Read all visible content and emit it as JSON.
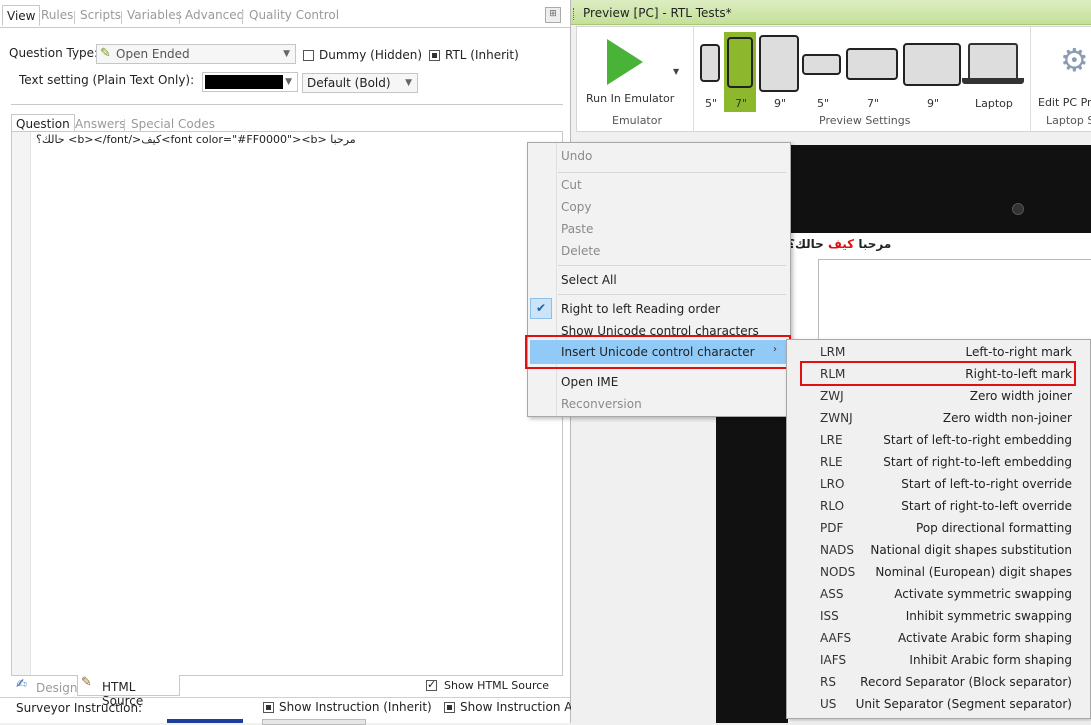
{
  "left": {
    "tabs": [
      "View",
      "Rules",
      "Scripts",
      "Variables",
      "Advanced",
      "Quality Control"
    ],
    "question_type_label": "Question Type:",
    "question_type_value": "Open Ended",
    "dummy_label": "Dummy (Hidden)",
    "rtl_label": "RTL (Inherit)",
    "text_setting_label": "Text setting (Plain Text Only):",
    "font_style_value": "Default (Bold)",
    "text_color": "#000000",
    "inner_tabs": [
      "Question",
      "Answers",
      "Special Codes"
    ],
    "editor_text": "مرحبا <font color=\"#FF0000\"><b>كيف</b></font> حالك؟",
    "bottom_tabs": [
      "Design",
      "HTML Source"
    ],
    "show_html_source_label": "Show HTML Source",
    "surveyor_instruction_label": "Surveyor Instruction:",
    "show_instruction_inherit_label": "Show Instruction (Inherit)",
    "show_instruction_al_label": "Show Instruction Al"
  },
  "right": {
    "title": "Preview [PC] - RTL Tests*",
    "run_emulator_label": "Run In Emulator",
    "emulator_group": "Emulator",
    "preview_group": "Preview Settings",
    "device_labels": [
      "5\"",
      "7\"",
      "9\"",
      "5\"",
      "7\"",
      "9\"",
      "Laptop"
    ],
    "edit_label": "Edit PC Pro",
    "laptop_group": "Laptop S",
    "preview_text_main": "مرحبا",
    "preview_text_red": "كيف",
    "preview_text_end": "حالك؟",
    "accent_green": "#8db72d",
    "accent_red": "#e01010"
  },
  "context_menu": {
    "items": [
      "Undo",
      "Cut",
      "Copy",
      "Paste",
      "Delete",
      "Select All",
      "Right to left Reading order",
      "Show Unicode control characters",
      "Insert Unicode control character",
      "Open IME",
      "Reconversion"
    ]
  },
  "submenu": {
    "items": [
      {
        "code": "LRM",
        "name": "Left-to-right mark"
      },
      {
        "code": "RLM",
        "name": "Right-to-left mark"
      },
      {
        "code": "ZWJ",
        "name": "Zero width joiner"
      },
      {
        "code": "ZWNJ",
        "name": "Zero width non-joiner"
      },
      {
        "code": "LRE",
        "name": "Start of left-to-right embedding"
      },
      {
        "code": "RLE",
        "name": "Start of right-to-left embedding"
      },
      {
        "code": "LRO",
        "name": "Start of left-to-right override"
      },
      {
        "code": "RLO",
        "name": "Start of right-to-left override"
      },
      {
        "code": "PDF",
        "name": "Pop directional formatting"
      },
      {
        "code": "NADS",
        "name": "National digit shapes substitution"
      },
      {
        "code": "NODS",
        "name": "Nominal (European) digit shapes"
      },
      {
        "code": "ASS",
        "name": "Activate symmetric swapping"
      },
      {
        "code": "ISS",
        "name": "Inhibit symmetric swapping"
      },
      {
        "code": "AAFS",
        "name": "Activate Arabic form shaping"
      },
      {
        "code": "IAFS",
        "name": "Inhibit Arabic form shaping"
      },
      {
        "code": "RS",
        "name": "Record Separator (Block separator)"
      },
      {
        "code": "US",
        "name": "Unit Separator (Segment separator)"
      }
    ]
  }
}
